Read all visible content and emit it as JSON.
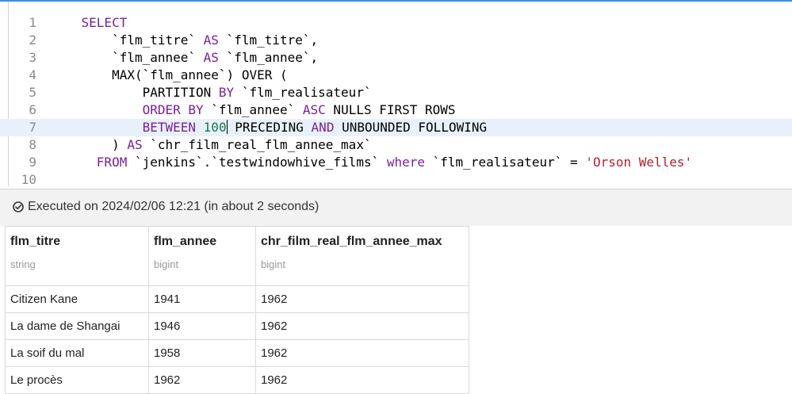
{
  "editor": {
    "lines": [
      {
        "no": "1",
        "tokens": [
          {
            "t": "    ",
            "c": ""
          },
          {
            "t": "SELECT",
            "c": "kw"
          }
        ]
      },
      {
        "no": "2",
        "tokens": [
          {
            "t": "        `flm_titre` ",
            "c": ""
          },
          {
            "t": "AS",
            "c": "kw"
          },
          {
            "t": " `flm_titre`,",
            "c": ""
          }
        ]
      },
      {
        "no": "3",
        "tokens": [
          {
            "t": "        `flm_annee` ",
            "c": ""
          },
          {
            "t": "AS",
            "c": "kw"
          },
          {
            "t": " `flm_annee`,",
            "c": ""
          }
        ]
      },
      {
        "no": "4",
        "tokens": [
          {
            "t": "        MAX(`flm_annee`) OVER (",
            "c": ""
          }
        ]
      },
      {
        "no": "5",
        "tokens": [
          {
            "t": "            PARTITION ",
            "c": ""
          },
          {
            "t": "BY",
            "c": "kw"
          },
          {
            "t": " `flm_realisateur`",
            "c": ""
          }
        ]
      },
      {
        "no": "6",
        "tokens": [
          {
            "t": "            ",
            "c": ""
          },
          {
            "t": "ORDER BY",
            "c": "kw"
          },
          {
            "t": " `flm_annee` ",
            "c": ""
          },
          {
            "t": "ASC",
            "c": "kw"
          },
          {
            "t": " NULLS FIRST ROWS",
            "c": ""
          }
        ]
      },
      {
        "no": "7",
        "tokens": [
          {
            "t": "            ",
            "c": ""
          },
          {
            "t": "BETWEEN",
            "c": "kw"
          },
          {
            "t": " ",
            "c": ""
          },
          {
            "t": "100",
            "c": "num"
          },
          {
            "t": "|",
            "c": "cursor"
          },
          {
            "t": " PRECEDING ",
            "c": ""
          },
          {
            "t": "AND",
            "c": "kw"
          },
          {
            "t": " UNBOUNDED FOLLOWING",
            "c": ""
          }
        ]
      },
      {
        "no": "8",
        "tokens": [
          {
            "t": "        ) ",
            "c": ""
          },
          {
            "t": "AS",
            "c": "kw"
          },
          {
            "t": " `chr_film_real_flm_annee_max`",
            "c": ""
          }
        ]
      },
      {
        "no": "9",
        "tokens": [
          {
            "t": "      ",
            "c": ""
          },
          {
            "t": "FROM",
            "c": "kw"
          },
          {
            "t": " `jenkins`.`testwindowhive_films` ",
            "c": ""
          },
          {
            "t": "where",
            "c": "kw"
          },
          {
            "t": " `flm_realisateur` = ",
            "c": ""
          },
          {
            "t": "'Orson Welles'",
            "c": "str"
          }
        ]
      },
      {
        "no": "10",
        "tokens": []
      }
    ],
    "active_line": 7
  },
  "status": {
    "icon": "check-circle-icon",
    "text": "Executed on 2024/02/06 12:21 (in about 2 seconds)"
  },
  "results": {
    "columns": [
      {
        "name": "flm_titre",
        "type": "string"
      },
      {
        "name": "flm_annee",
        "type": "bigint"
      },
      {
        "name": "chr_film_real_flm_annee_max",
        "type": "bigint"
      }
    ],
    "rows": [
      [
        "Citizen Kane",
        "1941",
        "1962"
      ],
      [
        "La dame de Shangai",
        "1946",
        "1962"
      ],
      [
        "La soif du mal",
        "1958",
        "1962"
      ],
      [
        "Le procès",
        "1962",
        "1962"
      ]
    ]
  },
  "colors": {
    "keyword": "#7a1f9c",
    "number": "#137a4a",
    "string": "#b3222b",
    "active_line_bg": "#e8f1fb",
    "editor_focus_border": "#3b8ee0"
  }
}
